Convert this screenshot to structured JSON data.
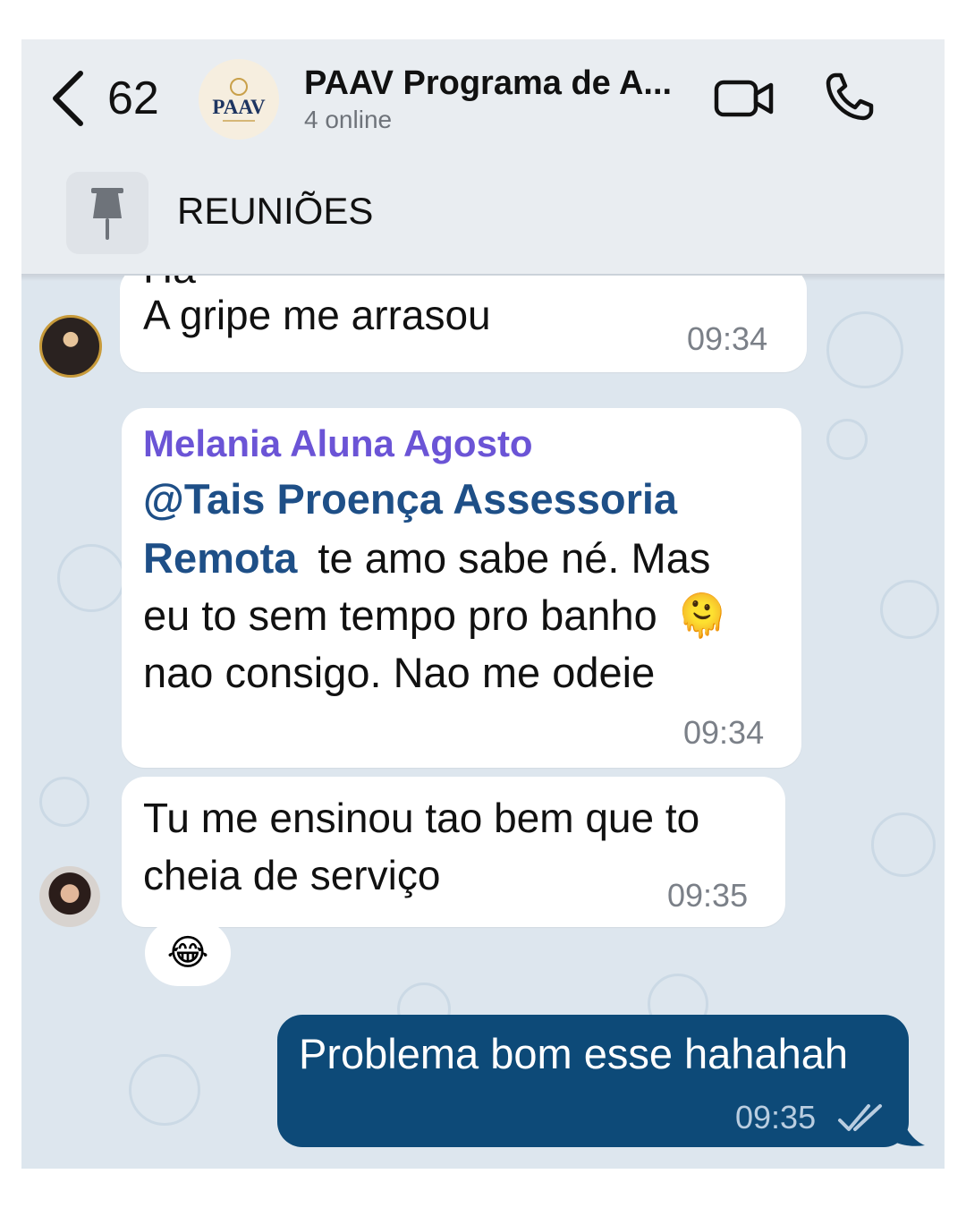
{
  "header": {
    "back_count": "62",
    "group_name": "PAAV Programa de A...",
    "status": "4 online",
    "avatar_logo": "PAAV",
    "icons": {
      "back": "chevron-left-icon",
      "video": "video-camera-icon",
      "call": "phone-icon"
    }
  },
  "pinned": {
    "label": "REUNIÕES",
    "icon": "pin-icon"
  },
  "messages": [
    {
      "partial_top": "Ha",
      "text": "A gripe me arrasou",
      "time": "09:34"
    },
    {
      "sender": "Melania Aluna Agosto",
      "mention": "@Tais Proença Assessoria Remota",
      "mention_line1": "@Tais Proença Assessoria",
      "mention_line2": "Remota",
      "line2_rest": " te amo sabe né. Mas",
      "line3": "eu to sem tempo pro banho",
      "emoji": "🫠",
      "line4": "nao consigo. Nao me odeie",
      "time": "09:34"
    },
    {
      "line1": "Tu me ensinou tao bem que to",
      "line2": "cheia de serviço",
      "time": "09:35",
      "reaction": "😂"
    },
    {
      "text": "Problema bom esse hahahah",
      "time": "09:35",
      "ticks": "double-check-icon"
    }
  ],
  "colors": {
    "header_bg": "#e9edf1",
    "chat_bg": "#dde6ee",
    "sender": "#6b54d6",
    "mention": "#1e4f87",
    "outgoing": "#0d4a78"
  }
}
